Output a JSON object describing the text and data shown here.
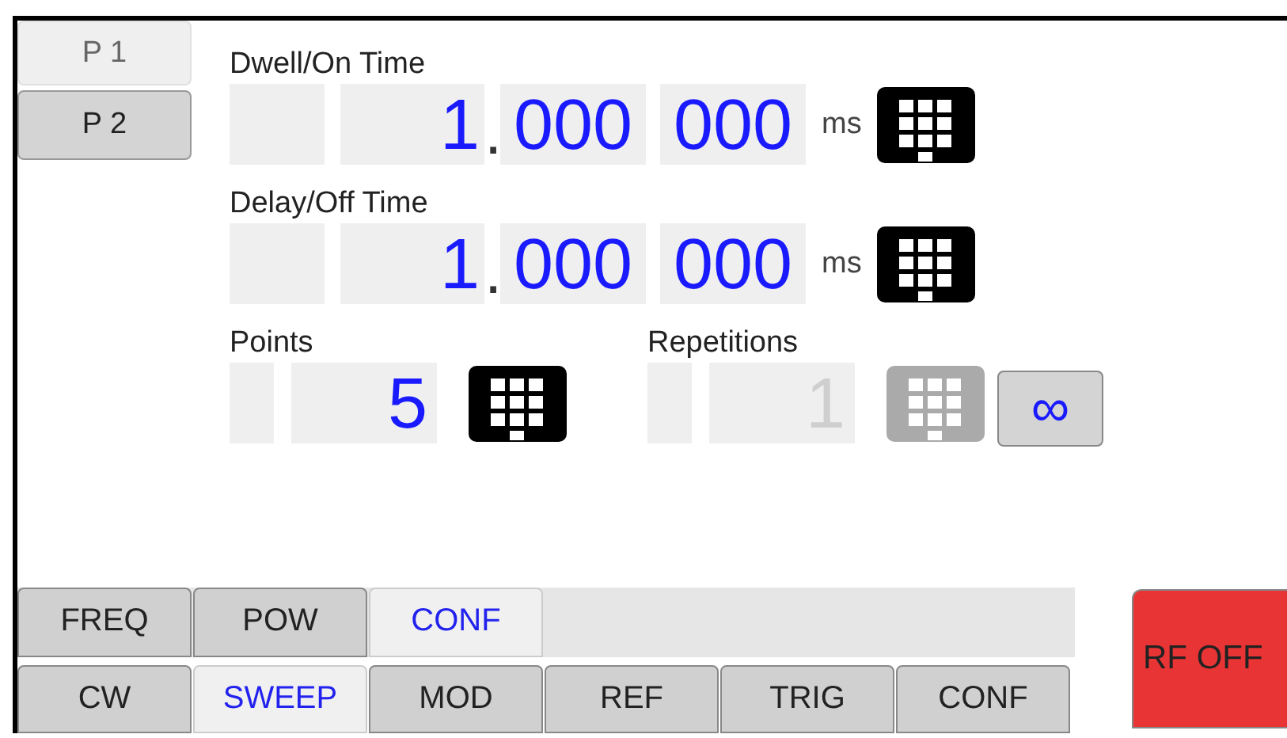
{
  "pages": [
    {
      "label": "P 1",
      "selected": true
    },
    {
      "label": "P 2",
      "selected": false
    }
  ],
  "timing": [
    {
      "label": "Dwell/On Time",
      "integer": "1",
      "separator": ".",
      "groups": [
        "000",
        "000"
      ],
      "unit": "ms"
    },
    {
      "label": "Delay/Off Time",
      "integer": "1",
      "separator": ".",
      "groups": [
        "000",
        "000"
      ],
      "unit": "ms"
    }
  ],
  "counts": [
    {
      "label": "Points",
      "value": "5",
      "disabled": false
    },
    {
      "label": "Repetitions",
      "value": "1",
      "disabled": true,
      "infinite_button": "∞"
    }
  ],
  "menu_tabs": [
    {
      "label": "FREQ",
      "selected": false
    },
    {
      "label": "POW",
      "selected": false
    },
    {
      "label": "CONF",
      "selected": true
    }
  ],
  "mode_tabs": [
    {
      "label": "CW",
      "selected": false
    },
    {
      "label": "SWEEP",
      "selected": true
    },
    {
      "label": "MOD",
      "selected": false
    },
    {
      "label": "REF",
      "selected": false
    },
    {
      "label": "TRIG",
      "selected": false
    },
    {
      "label": "CONF",
      "selected": false
    }
  ],
  "rf_button": {
    "label": "RF OFF",
    "on": false
  }
}
